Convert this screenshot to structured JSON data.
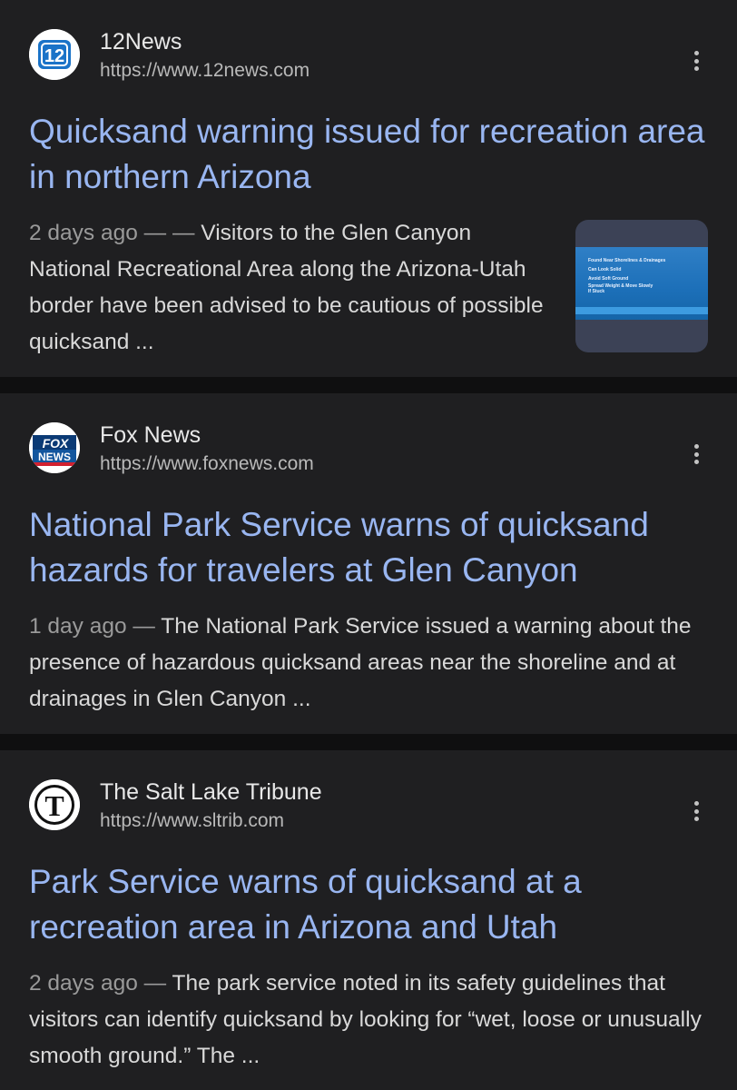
{
  "results": [
    {
      "site_name": "12News",
      "url": "https://www.12news.com",
      "favicon": "12news-logo",
      "headline": "Quicksand warning issued for recreation area in northern Arizona",
      "age": "2 days ago",
      "separator": " — — ",
      "snippet": "Visitors to the Glen Canyon National Recreational Area along the Arizona-Utah border have been advised to be cautious of possible quicksand ...",
      "thumbnail": {
        "lines": [
          "Found Near Shorelines & Drainages",
          "Can Look Solid",
          "Avoid Soft Ground",
          "Spread Weight & Move Slowly",
          "If Stuck"
        ]
      }
    },
    {
      "site_name": "Fox News",
      "url": "https://www.foxnews.com",
      "favicon": "fox-news-logo",
      "headline": "National Park Service warns of quicksand hazards for travelers at Glen Canyon",
      "age": "1 day ago",
      "separator": " — ",
      "snippet": "The National Park Service issued a warning about the presence of hazardous quicksand areas near the shoreline and at drainages in Glen Canyon ..."
    },
    {
      "site_name": "The Salt Lake Tribune",
      "url": "https://www.sltrib.com",
      "favicon": "salt-lake-tribune-logo",
      "headline": "Park Service warns of quicksand at a recreation area in Arizona and Utah",
      "age": "2 days ago",
      "separator": " — ",
      "snippet": "The park service noted in its safety guidelines that visitors can identify quicksand by looking for “wet, loose or unusually smooth ground.” The ..."
    }
  ],
  "logos": {
    "r0_mark": "12",
    "r1_top": "FOX",
    "r1_bottom": "NEWS",
    "r2_mark": "T"
  },
  "colors": {
    "background": "#0f0f10",
    "card": "#1f1f21",
    "headline": "#99b6f1",
    "snippet": "#d9d9d9",
    "age": "#9a9a9a",
    "url": "#b9b9b9"
  }
}
